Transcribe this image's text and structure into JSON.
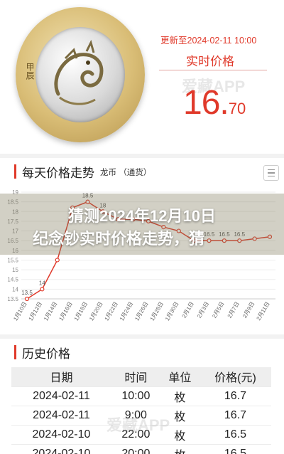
{
  "top": {
    "coin_left_text": "甲辰",
    "update_text": "更新至2024-02-11 10:00",
    "realtime_label": "实时价格",
    "price_int": "16.",
    "price_dec": "70",
    "watermark": "爱藏APP"
  },
  "trend": {
    "title": "每天价格走势",
    "subtitle": "龙币 （通货）",
    "menu_icon": "menu-icon"
  },
  "headline": {
    "line1": "猜测2024年12月10日",
    "line2": "纪念钞实时价格走势，猜"
  },
  "chart_data": {
    "type": "line",
    "x": [
      "1月10日",
      "1月12日",
      "1月14日",
      "1月16日",
      "1月18日",
      "1月20日",
      "1月22日",
      "1月24日",
      "1月26日",
      "1月28日",
      "1月30日",
      "2月1日",
      "2月3日",
      "2月5日",
      "2月7日",
      "2月9日",
      "2月11日"
    ],
    "yticks": [
      19,
      18.5,
      18,
      17.5,
      17,
      16.5,
      16,
      15.5,
      15,
      14.5,
      14,
      13.5
    ],
    "ylim": [
      13.5,
      19
    ],
    "visible_labels": [
      "18.5",
      "18",
      "16.5",
      "16.5",
      "16.5",
      "13.5",
      "14"
    ],
    "series": [
      {
        "values": [
          13.5,
          14,
          15.5,
          18.2,
          18.5,
          18,
          17.6,
          17.6,
          17.5,
          17.2,
          17.0,
          16.5,
          16.5,
          16.5,
          16.5,
          16.6,
          16.7
        ]
      }
    ],
    "color": "#e0392a"
  },
  "history": {
    "title": "历史价格",
    "headers": [
      "日期",
      "时间",
      "单位",
      "价格(元)"
    ],
    "rows": [
      [
        "2024-02-11",
        "10:00",
        "枚",
        "16.7"
      ],
      [
        "2024-02-11",
        "9:00",
        "枚",
        "16.7"
      ],
      [
        "2024-02-10",
        "22:00",
        "枚",
        "16.5"
      ],
      [
        "2024-02-10",
        "20:00",
        "枚",
        "16.5"
      ]
    ]
  }
}
